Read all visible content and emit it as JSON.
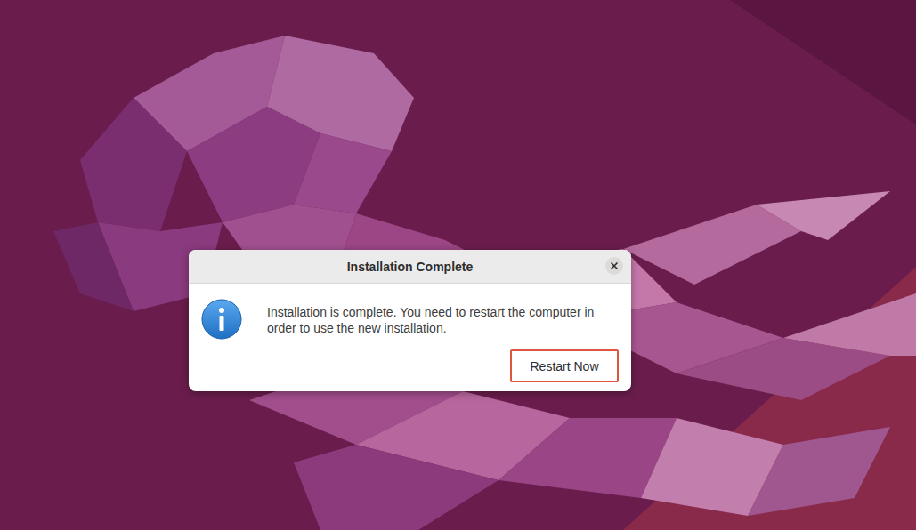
{
  "dialog": {
    "title": "Installation Complete",
    "message": "Installation is complete. You need to restart the computer in order to use the new installation.",
    "buttons": [
      {
        "label": "Restart Now",
        "highlighted": true
      }
    ]
  }
}
